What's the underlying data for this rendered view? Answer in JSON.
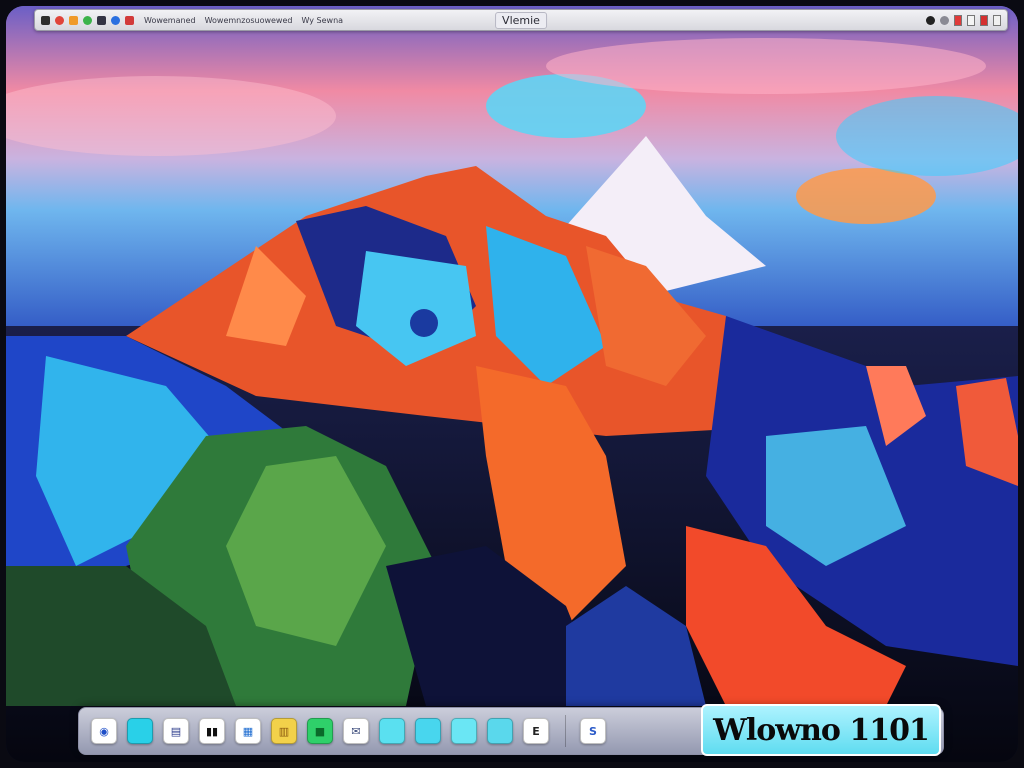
{
  "menubar": {
    "title": "Vlemie",
    "menus": [
      "Wowemaned",
      "Wowemnzosuowewed",
      "Wy Sewna"
    ],
    "left_icons": [
      {
        "name": "apple-icon",
        "color": "#2e2e2e"
      },
      {
        "name": "app-icon-red",
        "color": "#e0443a"
      },
      {
        "name": "app-icon-orange",
        "color": "#f09a2a"
      },
      {
        "name": "app-icon-green",
        "color": "#3bb34a"
      },
      {
        "name": "app-icon-dark",
        "color": "#333344"
      },
      {
        "name": "app-icon-blue",
        "color": "#2a6fe0"
      },
      {
        "name": "app-icon-red-2",
        "color": "#d23a3a"
      }
    ],
    "right_icons": [
      {
        "name": "status-icon-dark",
        "color": "#222222"
      },
      {
        "name": "status-icon-grey",
        "color": "#8a8a94"
      },
      {
        "name": "flag-red",
        "color": "#e03a3a"
      },
      {
        "name": "flag-white",
        "color": "#f4f4f4"
      },
      {
        "name": "flag-red-2",
        "color": "#d43030"
      },
      {
        "name": "flag-white-2",
        "color": "#f0f0f0"
      }
    ]
  },
  "dock": {
    "items": [
      {
        "id": "finder",
        "name": "finder-icon",
        "glyph": "◉",
        "bg": "#ffffff",
        "fg": "#1f4fc8"
      },
      {
        "id": "app1",
        "name": "window-app-icon",
        "glyph": "",
        "bg": "#29d0e8",
        "fg": "#0b3b6a"
      },
      {
        "id": "app2",
        "name": "document-app-icon",
        "glyph": "▤",
        "bg": "#ffffff",
        "fg": "#2a3a8a"
      },
      {
        "id": "app3",
        "name": "pause-app-icon",
        "glyph": "▮▮",
        "bg": "#ffffff",
        "fg": "#111111"
      },
      {
        "id": "app4",
        "name": "calendar-app-icon",
        "glyph": "▦",
        "bg": "#ffffff",
        "fg": "#1a6ad0"
      },
      {
        "id": "app5",
        "name": "notes-app-icon",
        "glyph": "▥",
        "bg": "#f2d14a",
        "fg": "#8a5a10"
      },
      {
        "id": "app6",
        "name": "messages-app-icon",
        "glyph": "■",
        "bg": "#2fd06a",
        "fg": "#0a6a2a"
      },
      {
        "id": "app7",
        "name": "mail-app-icon",
        "glyph": "✉",
        "bg": "#ffffff",
        "fg": "#3a4a7a"
      },
      {
        "id": "app8",
        "name": "cyan-app-icon-1",
        "glyph": "",
        "bg": "#5ae0f0",
        "fg": "#0a3a5a"
      },
      {
        "id": "app9",
        "name": "cyan-app-icon-2",
        "glyph": "",
        "bg": "#48d6ee",
        "fg": "#0a3a5a"
      },
      {
        "id": "app10",
        "name": "cyan-app-icon-3",
        "glyph": "",
        "bg": "#6ae6f4",
        "fg": "#0a3a5a"
      },
      {
        "id": "app11",
        "name": "cyan-app-icon-4",
        "glyph": "",
        "bg": "#5ad8ec",
        "fg": "#0a3a5a"
      },
      {
        "id": "app12",
        "name": "editor-app-icon",
        "glyph": "E",
        "bg": "#ffffff",
        "fg": "#222222"
      }
    ],
    "trash": {
      "name": "trash-icon",
      "glyph": "S",
      "bg": "#ffffff",
      "fg": "#2a5ac8"
    },
    "clock_text": "Wlowno 1101"
  }
}
